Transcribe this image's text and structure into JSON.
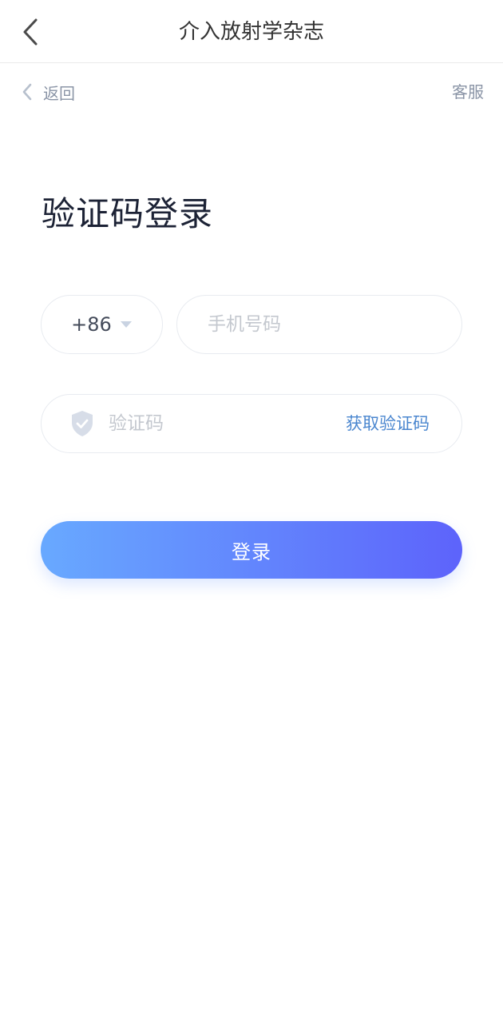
{
  "navbar": {
    "title": "介入放射学杂志",
    "back_icon": "chevron-left-icon"
  },
  "subbar": {
    "back_label": "返回",
    "back_icon": "chevron-left-icon",
    "service_label": "客服"
  },
  "form": {
    "heading": "验证码登录",
    "country_code": "+86",
    "country_code_icon": "caret-down-icon",
    "phone_placeholder": "手机号码",
    "phone_value": "",
    "code_icon": "shield-check-icon",
    "code_placeholder": "验证码",
    "code_value": "",
    "get_code_label": "获取验证码",
    "login_label": "登录"
  },
  "colors": {
    "title_text": "#333333",
    "secondary_text": "#8a94a6",
    "heading_text": "#1c2235",
    "link_blue": "#4a86cf",
    "button_gradient_start": "#68a9ff",
    "button_gradient_end": "#5d63fb",
    "placeholder": "#c4c8cf",
    "field_border": "#e8ebf0"
  }
}
